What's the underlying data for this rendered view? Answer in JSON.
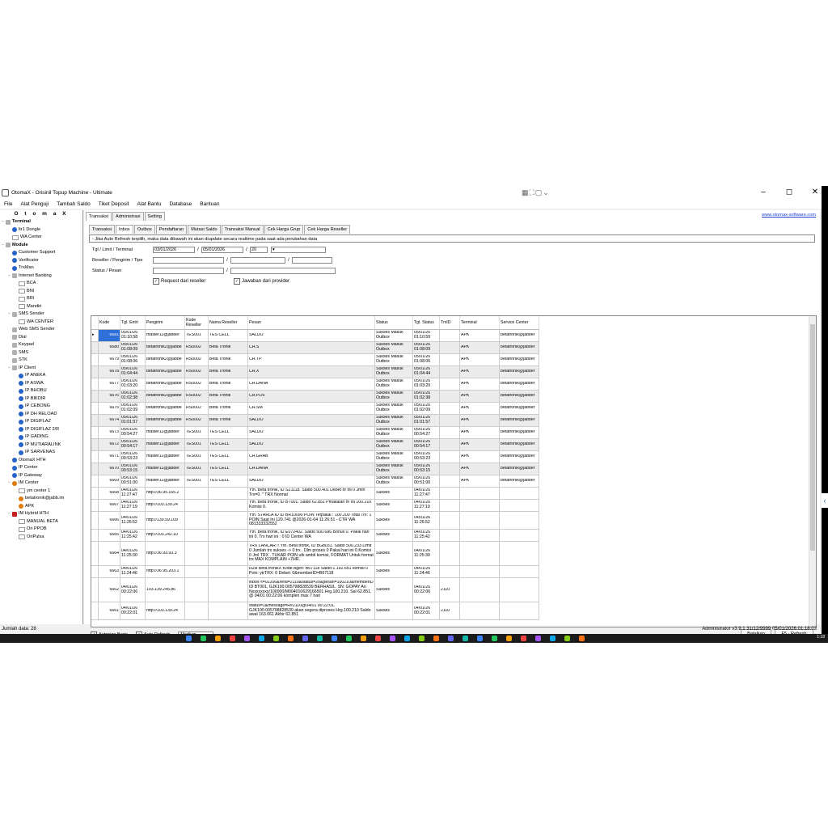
{
  "window": {
    "title": "OtomaX - Orisinil Topup Machine - Ultimate",
    "controls": {
      "minimize": "–",
      "maximize": "◻",
      "close": "✕"
    }
  },
  "menu": [
    "File",
    "Alat Penguji",
    "Tambah Saldo",
    "Tiket Deposit",
    "Alat Bantu",
    "Database",
    "Bantuan"
  ],
  "sidebar": {
    "brand": "O t o m a X",
    "items": [
      {
        "label": "Terminal",
        "level": 0,
        "icon": "terminal",
        "expand": "−",
        "bold": true
      },
      {
        "label": "ltr1 Dongle",
        "level": 1,
        "icon": "blue"
      },
      {
        "label": "WA Center",
        "level": 1,
        "icon": "none"
      },
      {
        "label": "Module",
        "level": 0,
        "icon": "module",
        "expand": "−",
        "bold": true
      },
      {
        "label": "Customer Support",
        "level": 1,
        "icon": "blue"
      },
      {
        "label": "Verificator",
        "level": 1,
        "icon": "blue"
      },
      {
        "label": "TrxMan",
        "level": 1,
        "icon": "blue"
      },
      {
        "label": "Internet Banking",
        "level": 1,
        "icon": "gray",
        "expand": "−"
      },
      {
        "label": "BCA",
        "level": 2,
        "icon": "none"
      },
      {
        "label": "BNI",
        "level": 2,
        "icon": "none"
      },
      {
        "label": "BRI",
        "level": 2,
        "icon": "none"
      },
      {
        "label": "Mandiri",
        "level": 2,
        "icon": "none"
      },
      {
        "label": "SMS Sender",
        "level": 1,
        "icon": "gray",
        "expand": "−"
      },
      {
        "label": "WA CENTER",
        "level": 2,
        "icon": "none"
      },
      {
        "label": "Web SMS Sender",
        "level": 1,
        "icon": "gray"
      },
      {
        "label": "Dial",
        "level": 1,
        "icon": "gray"
      },
      {
        "label": "Keypad",
        "level": 1,
        "icon": "gray"
      },
      {
        "label": "SMS",
        "level": 1,
        "icon": "gray"
      },
      {
        "label": "STK",
        "level": 1,
        "icon": "gray"
      },
      {
        "label": "IP Client",
        "level": 1,
        "icon": "gray",
        "expand": "−"
      },
      {
        "label": "IP ANEKA",
        "level": 2,
        "icon": "blue"
      },
      {
        "label": "IP ASWA",
        "level": 2,
        "icon": "blue"
      },
      {
        "label": "IP BHOBU",
        "level": 2,
        "icon": "blue"
      },
      {
        "label": "IP BIKDIR",
        "level": 2,
        "icon": "blue"
      },
      {
        "label": "IP CEBONG",
        "level": 2,
        "icon": "blue"
      },
      {
        "label": "IP DH RELOAD",
        "level": 2,
        "icon": "blue"
      },
      {
        "label": "IP DIGIFLAZ",
        "level": 2,
        "icon": "blue"
      },
      {
        "label": "IP DIGIFLAZ 2/R",
        "level": 2,
        "icon": "blue"
      },
      {
        "label": "IP GADING",
        "level": 2,
        "icon": "blue"
      },
      {
        "label": "IP MUTIARALINK",
        "level": 2,
        "icon": "blue"
      },
      {
        "label": "IP SARVENAS",
        "level": 2,
        "icon": "blue"
      },
      {
        "label": "OtomaX HTH",
        "level": 1,
        "icon": "blue"
      },
      {
        "label": "IP Center",
        "level": 1,
        "icon": "blue"
      },
      {
        "label": "IP Gateway",
        "level": 1,
        "icon": "blue"
      },
      {
        "label": "IM Center",
        "level": 1,
        "icon": "orange",
        "expand": "−"
      },
      {
        "label": "ym center 1",
        "level": 2,
        "icon": "none"
      },
      {
        "label": "betatronik@jabb.im",
        "level": 2,
        "icon": "orange"
      },
      {
        "label": "APK",
        "level": 2,
        "icon": "orange"
      },
      {
        "label": "IM Hybrid HTH",
        "level": 1,
        "icon": "red",
        "expand": "−"
      },
      {
        "label": "MANUAL BETA",
        "level": 2,
        "icon": "none"
      },
      {
        "label": "Ori PPOB",
        "level": 2,
        "icon": "none"
      },
      {
        "label": "OriPulsa",
        "level": 2,
        "icon": "none"
      }
    ],
    "footer": "Jumlah data: 28"
  },
  "top_tabs": [
    "Transaksi",
    "Administrasi",
    "Setting"
  ],
  "top_tab_active": 0,
  "website_link": "www.otomax-software.com",
  "sub_tabs": [
    "Transaksi",
    "Inbox",
    "Outbox",
    "Pendaftaran",
    "Mutasi Saldo",
    "Transaksi Manual",
    "Cek Harga Grup",
    "Cek Harga Reseller"
  ],
  "sub_tab_active": 1,
  "notice": "- Jika Auto Refresh terpilih, maka data dibawah ini akan diupdate secara realtime pada saat ada perubahan data",
  "filters": {
    "row1_label": "Tgl / Limit / Terminal",
    "date_from": "03/01/2026",
    "date_to": "05/01/2026",
    "limit": "20",
    "row2_label": "Reseller / Pengirim / Tipe",
    "row3_label": "Status / Pesan",
    "check_request": "Request dari reseller",
    "check_response": "Jawaban dari provider",
    "sep": "/"
  },
  "table": {
    "columns": [
      "Kode",
      "Tgl. Entri",
      "Pengirim",
      "Kode Reseller",
      "Nama Reseller",
      "Pesan",
      "Status",
      "Tgl. Status",
      "TrxID",
      "Terminal",
      "Service Center"
    ],
    "rows": [
      {
        "kode": "6681",
        "entri": "05/01/26 01:10:58",
        "pengirim": "master11@jabber",
        "kr": "TES001",
        "nr": "TES CELL",
        "pesan": "SALDO",
        "status": "Sukses Masuk Outbox",
        "ts": "05/01/26 01:10:59",
        "trx": "",
        "term": "APK",
        "sc": "betatronik@jabber",
        "h": 15
      },
      {
        "kode": "6680",
        "entri": "05/01/26 01:08:09",
        "pengirim": "betatronik2@jabbe",
        "kr": "RS0002",
        "nr": "Beta Tronik",
        "pesan": "CH.S",
        "status": "Sukses Masuk Outbox",
        "ts": "05/01/26 01:08:09",
        "trx": "",
        "term": "APK",
        "sc": "betatronik@jabber",
        "h": 15
      },
      {
        "kode": "6679",
        "entri": "05/01/26 01:08:06",
        "pengirim": "betatronik2@jabbe",
        "kr": "RS0002",
        "nr": "Beta Tronik",
        "pesan": "CH.TP",
        "status": "Sukses Masuk Outbox",
        "ts": "05/01/26 01:08:06",
        "trx": "",
        "term": "APK",
        "sc": "betatronik@jabber",
        "h": 15
      },
      {
        "kode": "6678",
        "entri": "05/01/26 01:04:44",
        "pengirim": "betatronik2@jabbe",
        "kr": "RS0002",
        "nr": "Beta Tronik",
        "pesan": "CH.X",
        "status": "Sukses Masuk Outbox",
        "ts": "05/01/26 01:04:44",
        "trx": "",
        "term": "APK",
        "sc": "betatronik@jabber",
        "h": 15
      },
      {
        "kode": "6677",
        "entri": "05/01/26 01:03:20",
        "pengirim": "betatronik2@jabbe",
        "kr": "RS0002",
        "nr": "Beta Tronik",
        "pesan": "CH.DANA",
        "status": "Sukses Masuk Outbox",
        "ts": "05/01/26 01:03:20",
        "trx": "",
        "term": "APK",
        "sc": "betatronik@jabber",
        "h": 15
      },
      {
        "kode": "6676",
        "entri": "05/01/26 01:02:38",
        "pengirim": "betatronik2@jabbe",
        "kr": "RS0002",
        "nr": "Beta Tronik",
        "pesan": "CH.PLN",
        "status": "Sukses Masuk Outbox",
        "ts": "05/01/26 01:02:38",
        "trx": "",
        "term": "APK",
        "sc": "betatronik@jabber",
        "h": 15
      },
      {
        "kode": "6675",
        "entri": "05/01/26 01:02:09",
        "pengirim": "betatronik2@jabbe",
        "kr": "RS0002",
        "nr": "Beta Tronik",
        "pesan": "CH.SM",
        "status": "Sukses Masuk Outbox",
        "ts": "05/01/26 01:02:09",
        "trx": "",
        "term": "APK",
        "sc": "betatronik@jabber",
        "h": 15
      },
      {
        "kode": "6674",
        "entri": "05/01/26 01:01:57",
        "pengirim": "betatronik2@jabbe",
        "kr": "RS0002",
        "nr": "Beta Tronik",
        "pesan": "SALDO",
        "status": "Sukses Masuk Outbox",
        "ts": "05/01/26 01:01:57",
        "trx": "",
        "term": "APK",
        "sc": "betatronik@jabber",
        "h": 15
      },
      {
        "kode": "6673",
        "entri": "05/01/26 00:54:27",
        "pengirim": "master11@jabber",
        "kr": "TES001",
        "nr": "TES CELL",
        "pesan": "SALDO",
        "status": "Sukses Masuk Outbox",
        "ts": "05/01/26 00:54:27",
        "trx": "",
        "term": "APK",
        "sc": "betatronik@jabber",
        "h": 15
      },
      {
        "kode": "6672",
        "entri": "05/01/26 00:54:17",
        "pengirim": "master11@jabber",
        "kr": "TES001",
        "nr": "TES CELL",
        "pesan": "SALDO",
        "status": "Sukses Masuk Outbox",
        "ts": "05/01/26 00:54:17",
        "trx": "",
        "term": "APK",
        "sc": "betatronik@jabber",
        "h": 15
      },
      {
        "kode": "6671",
        "entri": "05/01/26 00:53:23",
        "pengirim": "master11@jabber",
        "kr": "TES001",
        "nr": "TES CELL",
        "pesan": "CH.GRAB",
        "status": "Sukses Masuk Outbox",
        "ts": "05/01/26 00:53:23",
        "trx": "",
        "term": "APK",
        "sc": "betatronik@jabber",
        "h": 15
      },
      {
        "kode": "6670",
        "entri": "05/01/26 00:53:15",
        "pengirim": "master11@jabber",
        "kr": "TES001",
        "nr": "TES CELL",
        "pesan": "CH.DANA",
        "status": "Sukses Masuk Outbox",
        "ts": "05/01/26 00:53:15",
        "trx": "",
        "term": "APK",
        "sc": "betatronik@jabber",
        "h": 15
      },
      {
        "kode": "6669",
        "entri": "05/01/26 00:51:00",
        "pengirim": "master11@jabber",
        "kr": "TES001",
        "nr": "TES CELL",
        "pesan": "SALDO",
        "status": "Sukses Masuk Outbox",
        "ts": "05/01/26 00:51:00",
        "trx": "",
        "term": "APK",
        "sc": "betatronik@jabber",
        "h": 15
      },
      {
        "kode": "6668",
        "entri": "04/01/26 11:27:47",
        "pengirim": "http://36.95.165.2",
        "kr": "",
        "nr": "",
        "pesan": "Yth. Beta tronik, ID SZ1118. Saldo 500.401 Debet hr ini 0 Jmlh Trx=0. \" TRX Normal",
        "status": "Sukses",
        "ts": "04/01/26 11:27:47",
        "trx": "",
        "term": "",
        "sc": "",
        "h": 15
      },
      {
        "kode": "6667",
        "entri": "04/01/26 11:27:19",
        "pengirim": "http://103.139.24",
        "kr": "",
        "nr": "",
        "pesan": "Yth. Beta tronik, ID BT001. Saldo 62.851 Pmakaian hr ini 100.210 Komisi 0.",
        "status": "Sukses",
        "ts": "04/01/26 11:27:19",
        "trx": "",
        "term": "",
        "sc": "",
        "h": 15
      },
      {
        "kode": "6666",
        "entri": "04/01/26 11:26:52",
        "pengirim": "http://139.59.109",
        "kr": "",
        "nr": "",
        "pesan": "Yth. STARLA ID ID BR10090 POIN Terpakai : 100.200 Total Trx: 1 POIN Saat Ini 120.741 @2026-01-04 11:26:51 - CTR WA 081333332552",
        "status": "Sukses",
        "ts": "04/01/26 11:26:52",
        "trx": "",
        "term": "",
        "sc": "",
        "h": 22
      },
      {
        "kode": "6665",
        "entri": "04/01/26 11:25:42",
        "pengirim": "http://103.242.10",
        "kr": "",
        "nr": "",
        "pesan": "Yth. Beta tronik, ID E072402. Saldo 500.686 Bonus 0. Pakai hari ini 0. Trx hari ini : 0 ID Center WA",
        "status": "Sukses",
        "ts": "04/01/26 11:25:42",
        "trx": "",
        "term": "",
        "sc": "",
        "h": 15
      },
      {
        "kode": "6664",
        "entri": "04/01/26 11:25:30",
        "pengirim": "http://36.93.93.3",
        "kr": "",
        "nr": "",
        "pesan": "TRX LANCAR !! Yth. Beta tronik, ID BG8031. Saldo 500.233 Limit 0 Jumlah trx sukses -> 0 trx . Dlm proses 0 Pakai hari ini 0 Komisi 0 Jml TRX . TUKAR POIN utk ambil komisi, FORMAT Untuk format trx MAX KOMPLAIN +7HR.",
        "status": "Sukses",
        "ts": "04/01/26 11:25:30",
        "trx": "",
        "term": "",
        "sc": "",
        "h": 30
      },
      {
        "kode": "6663",
        "entri": "04/01/26 11:24:46",
        "pengirim": "http://36.95.203.1",
        "kr": "",
        "nr": "",
        "pesan": "H2H Beta tronikX Kode Agen: B67118 Saldo:1.192.651 komisi 0 Poin: ytrTRX: 0 Debet: 0&memberID=B67118",
        "status": "Sukses",
        "ts": "04/01/26 11:24:46",
        "trx": "",
        "term": "",
        "sc": "",
        "h": 15
      },
      {
        "kode": "6662",
        "entri": "04/01/26 00:22:06",
        "pengirim": "103.139.245.86",
        "kr": "",
        "nr": "",
        "pesan": "inbox?t=02206&refid=2110&status=20&pesan=100210&memberID ID BT001, GJK100.005798828539 BERHASIL. SN: GOPAY An Nxxxxxxxx/100000/M004010629166501 Hrg.100.210. Sal 62.851. @ 04/01 00:22:06 komplen max 7 hari",
        "status": "Sukses",
        "ts": "04/01/26 00:22:06",
        "trx": "2110",
        "term": "",
        "sc": "",
        "h": 30
      },
      {
        "kode": "6661",
        "entri": "04/01/26 00:22:01",
        "pengirim": "http://103.139.24",
        "kr": "",
        "nr": "",
        "pesan": "status=1&message=R#2110@04/01 00:22:01. GJK100.005798828539 akan segera diproses Hrg.100.210 Saldo awal 163.061 Akhir 62.851",
        "status": "Sukses",
        "ts": "04/01/26 00:22:01",
        "trx": "2110",
        "term": "",
        "sc": "",
        "h": 22
      }
    ]
  },
  "bottom": {
    "autosize": "Autosize Baris",
    "autorefresh": "Auto Refresh",
    "speed": "Medium",
    "btn_cancel": "Batalkan",
    "btn_refresh": "F5 - Refresh"
  },
  "statusbar": {
    "text": "Administrator  v3.9.1  31/12/9999  05/01/2026 01:18:03"
  },
  "taskbar": {
    "time": "1:18"
  }
}
